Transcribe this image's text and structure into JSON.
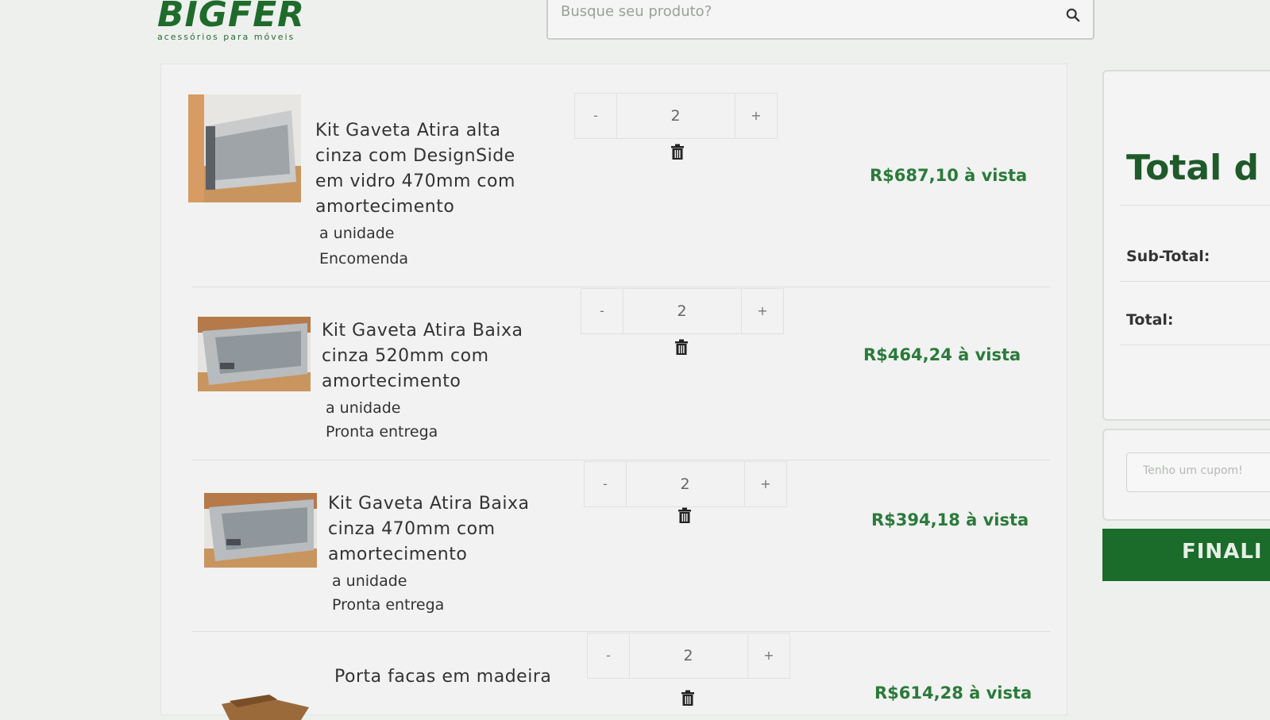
{
  "logo": {
    "word": "BIGFER",
    "tagline": "acessórios para móveis"
  },
  "search": {
    "placeholder": "Busque seu produto?"
  },
  "cart": {
    "items": [
      {
        "name_lines": [
          "Kit Gaveta Atira alta",
          "cinza com DesignSide",
          "em vidro 470mm com",
          "amortecimento"
        ],
        "unit": "a unidade",
        "availability": "Encomenda",
        "quantity": "2",
        "minus": "-",
        "plus": "+",
        "price": "R$687,10 à vista"
      },
      {
        "name_lines": [
          "Kit Gaveta Atira Baixa",
          "cinza 520mm com",
          "amortecimento"
        ],
        "unit": "a unidade",
        "availability": "Pronta entrega",
        "quantity": "2",
        "minus": "-",
        "plus": "+",
        "price": "R$464,24 à vista"
      },
      {
        "name_lines": [
          "Kit Gaveta Atira Baixa",
          "cinza 470mm com",
          "amortecimento"
        ],
        "unit": "a unidade",
        "availability": "Pronta entrega",
        "quantity": "2",
        "minus": "-",
        "plus": "+",
        "price": "R$394,18 à vista"
      },
      {
        "name_lines": [
          "Porta facas em madeira"
        ],
        "quantity": "2",
        "minus": "-",
        "plus": "+",
        "price": "R$614,28 à vista"
      }
    ]
  },
  "summary": {
    "title": "Total d",
    "subtotal_label": "Sub-Total:",
    "total_label": "Total:"
  },
  "coupon": {
    "placeholder": "Tenho um cupom!"
  },
  "finalize_label": "FINALI",
  "colors": {
    "brand_green": "#1f6b2c",
    "price_green": "#2b7a3a",
    "button_green": "#1b6b2b"
  }
}
